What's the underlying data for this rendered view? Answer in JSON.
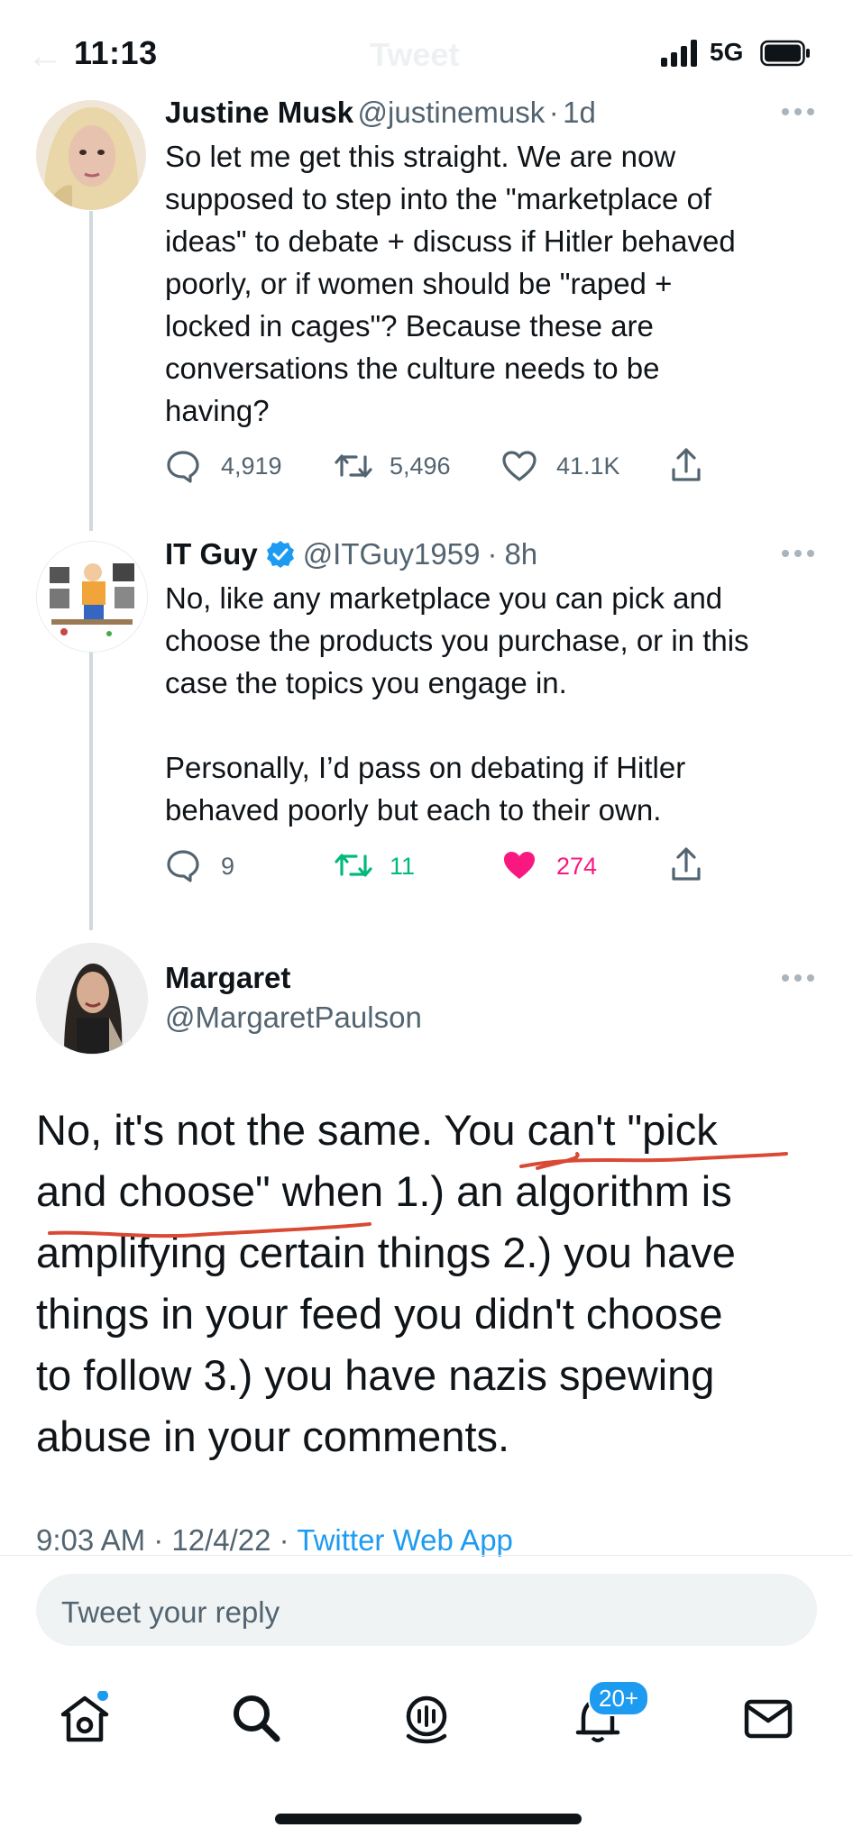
{
  "status_bar": {
    "time": "11:13",
    "network": "5G"
  },
  "header": {
    "back_glyph": "←",
    "title": "Tweet"
  },
  "tweets": [
    {
      "name": "Justine Musk",
      "handle": "@justinemusk",
      "time": "1d",
      "text": "So let me get this straight. We are now\nsupposed to step into the \"marketplace of\nideas\" to debate + discuss if Hitler behaved\npoorly, or if women should be \"raped +\nlocked in cages\"? Because these are\nconversations the culture needs to be\nhaving?",
      "replies": "4,919",
      "retweets": "5,496",
      "likes": "41.1K"
    },
    {
      "name": "IT Guy",
      "handle": "@ITGuy1959",
      "time": "8h",
      "verified": true,
      "text": "No, like any marketplace you can pick and\nchoose the products you purchase, or in this\ncase the topics you engage in.\n\nPersonally, I’d pass on debating if Hitler\nbehaved poorly but each to their own.",
      "replies": "9",
      "retweets": "11",
      "likes": "274",
      "liked": true
    }
  ],
  "main_tweet": {
    "name": "Margaret",
    "handle": "@MargaretPaulson",
    "text": "No, it's not the same. You can't \"pick\nand choose\" when 1.) an algorithm is\namplifying certain things 2.) you have\nthings in your feed you didn't choose\nto follow 3.) you have nazis spewing\nabuse in your comments.",
    "timestamp": "9:03 AM · 12/4/22 · ",
    "source": "Twitter Web App"
  },
  "reply": {
    "placeholder": "Tweet your reply"
  },
  "nav": {
    "notifications_badge": "20+"
  },
  "colors": {
    "text": "#0f1419",
    "secondary": "#536471",
    "link": "#1d9bf0",
    "retweet_green": "#00ba7c",
    "like_pink": "#f91880",
    "annotation_red": "#d94a35"
  },
  "icons": [
    "more-icon",
    "reply-icon",
    "retweet-icon",
    "like-icon",
    "share-icon",
    "verified-icon",
    "home-icon",
    "search-icon",
    "spaces-icon",
    "notifications-icon",
    "messages-icon"
  ]
}
